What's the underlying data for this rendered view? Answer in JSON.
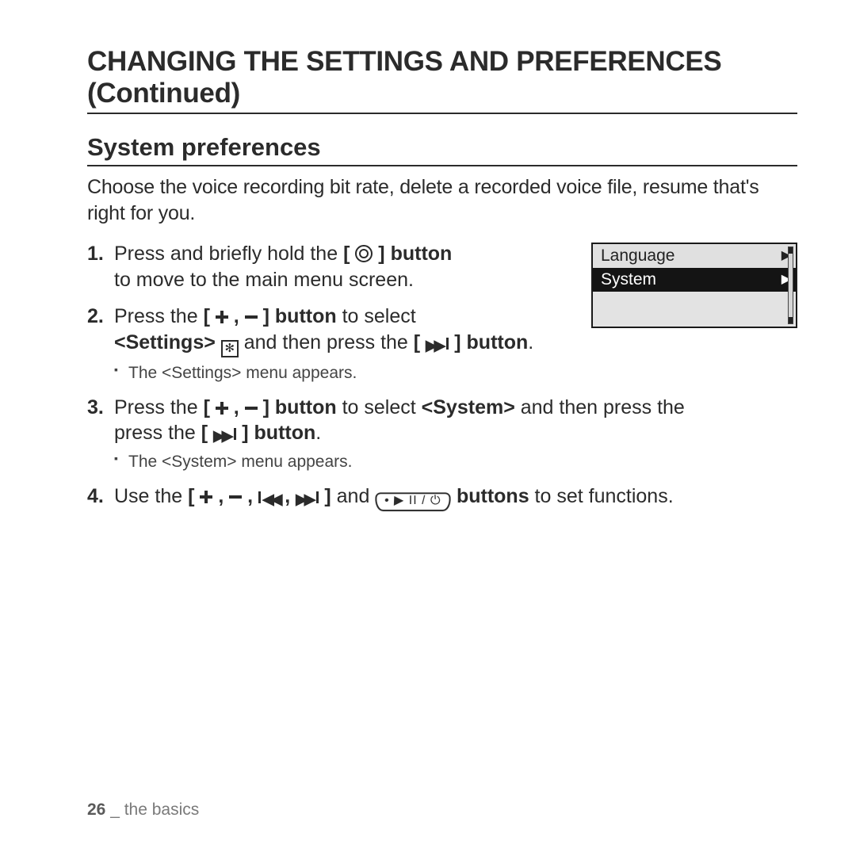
{
  "title": "CHANGING THE SETTINGS AND PREFERENCES (Continued)",
  "section": "System preferences",
  "intro": "Choose the voice recording bit rate, delete a recorded voice file, resume that's right for you.",
  "device": {
    "rows": [
      {
        "label": "Language",
        "selected": false
      },
      {
        "label": "System",
        "selected": true
      }
    ]
  },
  "steps": {
    "s1": {
      "prefix": "Press and briefly hold the ",
      "bracket_open": "[",
      "bracket_close": "]",
      "button_word": " button",
      "suffix": "to move to the main menu screen."
    },
    "s2": {
      "prefix": "Press the ",
      "bracket_open": "[",
      "sep": " , ",
      "bracket_close": "]",
      "button_word": " button",
      "to_select": " to select ",
      "settings_label": "<Settings>",
      "and_then": " and then press the ",
      "bracket_open2": "[",
      "bracket_close2": "]",
      "button_word2": " button",
      "dot": ".",
      "sub": "The <Settings> menu appears."
    },
    "s3": {
      "prefix": "Press the ",
      "bracket_open": "[",
      "sep": " , ",
      "bracket_close": "]",
      "button_word": " button",
      "to_select": " to select ",
      "system_label": "<System>",
      "and_then": " and then press the ",
      "bracket_open2": "[",
      "bracket_close2": "]",
      "button_word2": " button",
      "dot": ".",
      "sub": "The <System> menu appears."
    },
    "s4": {
      "prefix": "Use the ",
      "bracket_open": "[",
      "sep": " , ",
      "bracket_close": "]",
      "and": " and ",
      "buttons_word": " buttons",
      "suffix": " to set functions."
    }
  },
  "footer": {
    "page": "26",
    "sep": " _ ",
    "chapter": "the basics"
  },
  "glyphs": {
    "tri_right": "▶",
    "tri_left": "◀",
    "gear": "✻",
    "pill": "• ▶ II / ⏻"
  }
}
